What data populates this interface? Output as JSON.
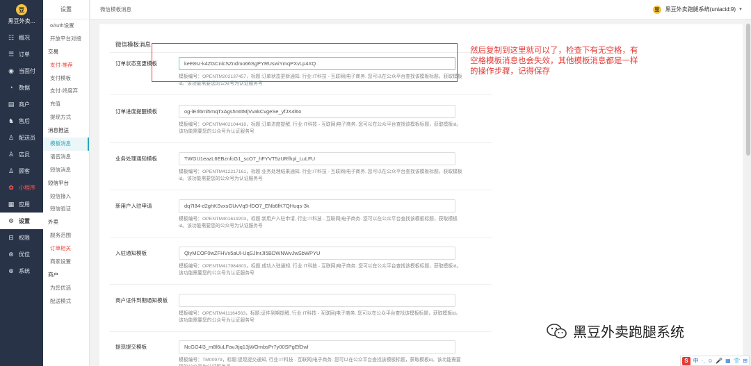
{
  "app": {
    "logo_badge": "豆",
    "name": "黑豆外卖...",
    "header_badge": "豆",
    "account": "黑豆外卖跑腿系统(uniacid:9)",
    "caret": "▼"
  },
  "sidebar": [
    {
      "icon": "☷",
      "label": "概况",
      "icon_name": "dashboard-icon"
    },
    {
      "icon": "☰",
      "label": "订单",
      "icon_name": "order-list-icon"
    },
    {
      "icon": "◉",
      "label": "当面付",
      "icon_name": "pay-icon"
    },
    {
      "icon": "◔",
      "label": "数据",
      "icon_name": "data-icon"
    },
    {
      "icon": "▤",
      "label": "商户",
      "icon_name": "store-icon"
    },
    {
      "icon": "♞",
      "label": "售后",
      "icon_name": "after-sale-icon"
    },
    {
      "icon": "♙",
      "label": "配送员",
      "icon_name": "courier-icon"
    },
    {
      "icon": "♙",
      "label": "店员",
      "icon_name": "staff-icon"
    },
    {
      "icon": "♙",
      "label": "顾客",
      "icon_name": "customer-icon"
    },
    {
      "icon": "✿",
      "label": "小程序",
      "icon_name": "miniprogram-icon",
      "red": true
    },
    {
      "icon": "▦",
      "label": "应用",
      "icon_name": "apps-icon"
    },
    {
      "icon": "⚙",
      "label": "设置",
      "icon_name": "settings-icon",
      "active": true
    },
    {
      "icon": "⊟",
      "label": "权限",
      "icon_name": "permission-icon"
    },
    {
      "icon": "⊛",
      "label": "优位",
      "icon_name": "position-icon"
    },
    {
      "icon": "⊕",
      "label": "系统",
      "icon_name": "system-icon"
    }
  ],
  "submenu": {
    "title": "设置",
    "rows": [
      {
        "label": "oAuth设置"
      },
      {
        "label": "开放平台对接"
      },
      {
        "label": "交易",
        "group": true
      },
      {
        "label": "支付·推荐",
        "red": true
      },
      {
        "label": "支付模板"
      },
      {
        "label": "支付·终度弃"
      },
      {
        "label": "充值"
      },
      {
        "label": "提现方式"
      },
      {
        "label": "消息推送",
        "group": true
      },
      {
        "label": "模板消息",
        "active": true
      },
      {
        "label": "语音消息"
      },
      {
        "label": "短信消息"
      },
      {
        "label": "短信平台",
        "group": true
      },
      {
        "label": "短信接入"
      },
      {
        "label": "短信验证"
      },
      {
        "label": "外卖",
        "group": true
      },
      {
        "label": "服务范围"
      },
      {
        "label": "订单相关",
        "red": true
      },
      {
        "label": "商家设置"
      },
      {
        "label": "商户",
        "group": true
      },
      {
        "label": "为您优选"
      },
      {
        "label": "配送模式"
      }
    ]
  },
  "header": {
    "breadcrumb": "微信模板消息"
  },
  "main": {
    "section_title": "微信模板消息",
    "fields": [
      {
        "label": "订单状态变更模板",
        "value": "keE8sr-k4ZGCnlcSZndmo66SgPYRUswiYmqPXvLp4XQ",
        "help": "模板编号：OPENTM202137457，标题:订单状态更新通知, 行业:IT科技 - 互联网|电子商务. 您可以在公众平台查找该模板标题，获取模板id。该功能需要您的公众号为认证服务号",
        "focus": true
      },
      {
        "label": "订单进度提醒模板",
        "value": "og-iErl6ml5mqTxAgs5n6tMjVvakCvgeSe_yfJX4l6o",
        "help": "模板编号：OPENTM402104418，标题:订单进度提醒, 行业:IT科技 - 互联网|电子商务. 您可以在公众平台查找该模板标题，获取模板id。该功能需要您的公众号为认证服务号"
      },
      {
        "label": "业务处理通知模板",
        "value": "TWGU1eazL6EBznfcG1_scO7_hFYVT5zURfhpl_LuLFU",
        "help": "模板编号：OPENTM412217161，标题:业务处理结果通知, 行业:IT科技 - 互联网|电子商务. 您可以在公众平台查找该模板标题，获取模板id。该功能需要您的公众号为认证服务号"
      },
      {
        "label": "新用户入驻申请",
        "value": "dq7I84-d2ghKSvxsGUvVq9-fDO7_ENb6fK7QHuqs-3k",
        "help": "模板编号：OPENTM401619203，标题:新用户入驻申请, 行业:IT科技 - 互联网|电子商务. 您可以在公众平台查找该模板标题，获取模板id。该功能需要您的公众号为认证服务号"
      },
      {
        "label": "入驻通知模板",
        "value": "QlyMCOF0wZFHVx5aUl-UqSJlnrJI5BDWNWvJwSbWPYU",
        "help": "模板编号：OPENTM417984803，标题:成功入驻通知, 行业:IT科技 - 互联网|电子商务. 您可以在公众平台查找该模板标题，获取模板id。该功能需要您的公众号为认证服务号"
      },
      {
        "label": "商户证件到期通知模板",
        "value": "",
        "help": "模板编号：OPENTM411164563，标题:证件到期提醒, 行业:IT科技 - 互联网|电子商务. 您可以在公众平台查找该模板标题，获取模板id。该功能需要您的公众号为认证服务号"
      },
      {
        "label": "提现提交模板",
        "value": "NcGG4l3_m8l6uLFavJtjq13jWOmbsPr7y00SPgEfDwl",
        "help": "模板编号：TM00979，标题:提现提交通知, 行业:IT科技 - 互联网|电子商务. 您可以在公众平台查找该模板标题，获取模板id。该功能需要您的公众号为认证服务号"
      }
    ]
  },
  "annotation": {
    "note": "然后复制到这里就可以了，检查下有无空格，有空格模板消息也会失效，其他模板消息都是一样的操作步骤，记得保存",
    "color": "#e53935"
  },
  "watermark": {
    "text": "黑豆外卖跑腿系统"
  },
  "ime": {
    "s": "S",
    "items": [
      "中",
      "·,",
      "☺",
      "🎤",
      "▦",
      "👕",
      "⊞"
    ]
  }
}
